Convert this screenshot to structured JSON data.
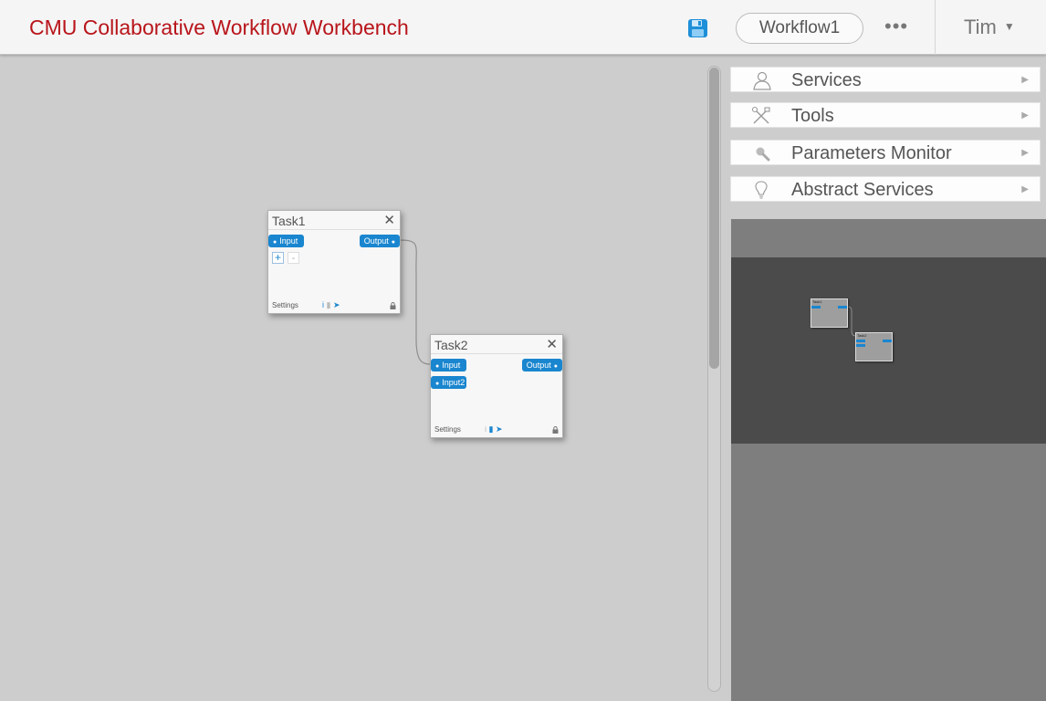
{
  "header": {
    "app_title": "CMU Collaborative Workflow Workbench",
    "workflow_name": "Workflow1",
    "more_label": "•••",
    "user_name": "Tim",
    "user_caret": "▼",
    "save_icon": "floppy-disk-icon"
  },
  "tasks": [
    {
      "title": "Task1",
      "close": "✕",
      "inputs": [
        "Input"
      ],
      "outputs": [
        "Output"
      ],
      "add_label": "+",
      "remove_label": "-",
      "footer_label": "Settings"
    },
    {
      "title": "Task2",
      "close": "✕",
      "inputs": [
        "Input",
        "Input2"
      ],
      "outputs": [
        "Output"
      ],
      "footer_label": "Settings"
    }
  ],
  "side_panels": [
    {
      "label": "Services",
      "icon": "user-icon",
      "arrow": "▶"
    },
    {
      "label": "Tools",
      "icon": "tools-icon",
      "arrow": "▶"
    },
    {
      "label": "Parameters Monitor",
      "icon": "magnifier-icon",
      "arrow": "▶"
    },
    {
      "label": "Abstract Services",
      "icon": "lightbulb-icon",
      "arrow": "▶"
    }
  ],
  "minimap": {
    "tasks": [
      "Task1",
      "Task2"
    ]
  },
  "colors": {
    "brand_red": "#b8151b",
    "port_blue": "#1a86cf",
    "canvas_gray": "#cdcdcd"
  }
}
